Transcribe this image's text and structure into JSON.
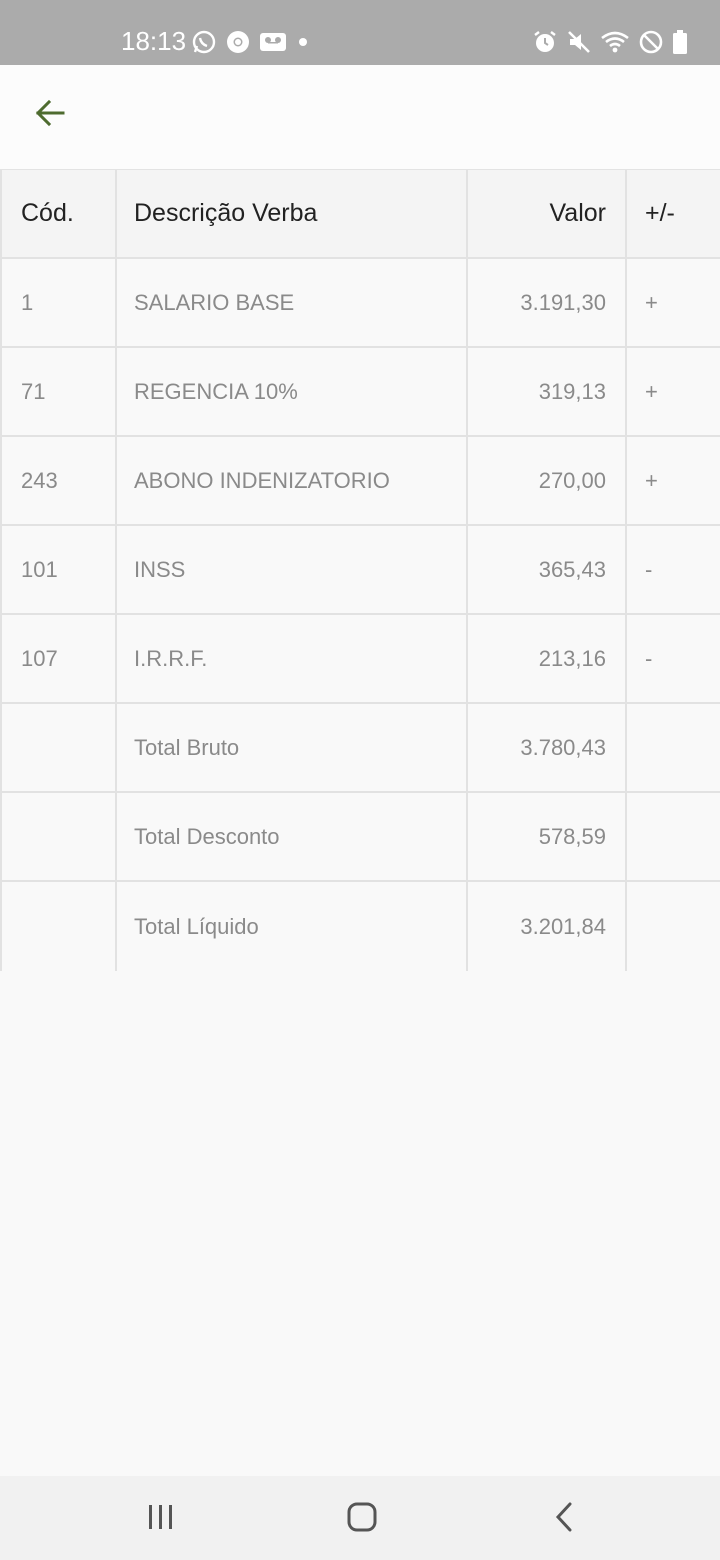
{
  "status_bar": {
    "time": "18:13",
    "left_icons": [
      "whatsapp-icon",
      "chrome-icon",
      "voicemail-icon",
      "dot-icon"
    ],
    "right_icons": [
      "alarm-icon",
      "mute-icon",
      "wifi-icon",
      "do-not-disturb-icon",
      "battery-icon"
    ]
  },
  "app_bar": {
    "back_icon": "arrow-left-icon",
    "accent_color": "#4e6b2f"
  },
  "table": {
    "headers": {
      "code": "Cód.",
      "description": "Descrição Verba",
      "value": "Valor",
      "sign": "+/-"
    },
    "rows": [
      {
        "code": "1",
        "description": "SALARIO BASE",
        "value": "3.191,30",
        "sign": "+"
      },
      {
        "code": "71",
        "description": "REGENCIA 10%",
        "value": "319,13",
        "sign": "+"
      },
      {
        "code": "243",
        "description": "ABONO INDENIZATORIO",
        "value": "270,00",
        "sign": "+"
      },
      {
        "code": "101",
        "description": "INSS",
        "value": "365,43",
        "sign": "-"
      },
      {
        "code": "107",
        "description": "I.R.R.F.",
        "value": "213,16",
        "sign": "-"
      },
      {
        "code": "",
        "description": "Total Bruto",
        "value": "3.780,43",
        "sign": ""
      },
      {
        "code": "",
        "description": "Total Desconto",
        "value": "578,59",
        "sign": ""
      },
      {
        "code": "",
        "description": "Total Líquido",
        "value": "3.201,84",
        "sign": ""
      }
    ]
  },
  "nav_bar": {
    "icons": [
      "recent-apps-icon",
      "home-icon",
      "back-nav-icon"
    ]
  }
}
